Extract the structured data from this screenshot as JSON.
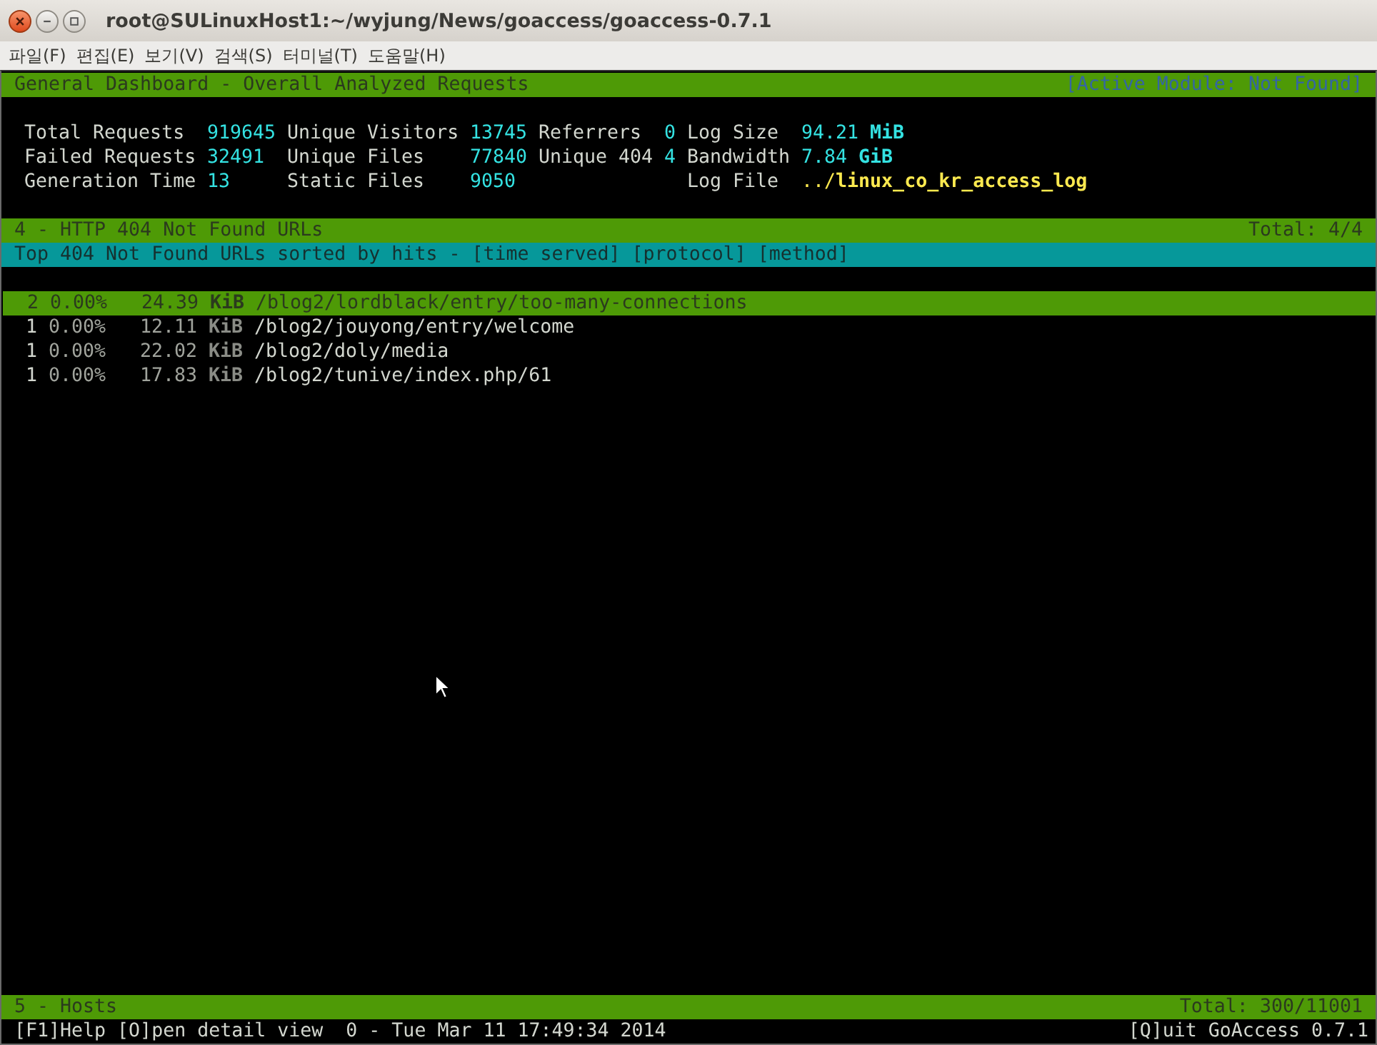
{
  "window": {
    "title": "root@SULinuxHost1:~/wyjung/News/goaccess/goaccess-0.7.1"
  },
  "menu": [
    "파일(F)",
    "편집(E)",
    "보기(V)",
    "검색(S)",
    "터미널(T)",
    "도움말(H)"
  ],
  "header": {
    "title": "General Dashboard - Overall Analyzed Requests",
    "active_module": "[Active Module: Not Found]"
  },
  "stats": [
    {
      "items": [
        {
          "label": "Total Requests",
          "value": "919645",
          "kind": "number"
        },
        {
          "label": "Failed Requests",
          "value": "32491",
          "kind": "number"
        },
        {
          "label": "Generation Time",
          "value": "13",
          "kind": "number"
        }
      ]
    },
    {
      "items": [
        {
          "label": "Unique Visitors",
          "value": "13745",
          "kind": "number"
        },
        {
          "label": "Unique Files",
          "value": "77840",
          "kind": "number"
        },
        {
          "label": "Static Files",
          "value": "9050",
          "kind": "number"
        }
      ]
    },
    {
      "items": [
        {
          "label": "Referrers",
          "value": "0",
          "kind": "number"
        },
        {
          "label": "Unique 404",
          "value": "4",
          "kind": "number"
        }
      ]
    },
    {
      "items": [
        {
          "label": "Log Size",
          "value": "94.21 **MiB**",
          "kind": "number"
        },
        {
          "label": "Bandwidth",
          "value": "7.84 **GiB**",
          "kind": "number"
        },
        {
          "label": "Log File",
          "value": "../**linux_co_kr_access_log**",
          "kind": "path"
        }
      ]
    }
  ],
  "module": {
    "title": "4 - HTTP 404 Not Found URLs",
    "total": "Total: 4/4",
    "subtitle": "Top 404 Not Found URLs sorted by hits - [time served] [protocol] [method]",
    "rows": [
      {
        "hits": "2",
        "percent": "0.00%",
        "bandwidth": "24.39 **KiB**",
        "url": "/blog2/lordblack/entry/too-many-connections",
        "selected": true
      },
      {
        "hits": "1",
        "percent": "0.00%",
        "bandwidth": "12.11 **KiB**",
        "url": "/blog2/jouyong/entry/welcome",
        "selected": false
      },
      {
        "hits": "1",
        "percent": "0.00%",
        "bandwidth": "22.02 **KiB**",
        "url": "/blog2/doly/media",
        "selected": false
      },
      {
        "hits": "1",
        "percent": "0.00%",
        "bandwidth": "17.83 **KiB**",
        "url": "/blog2/tunive/index.php/61",
        "selected": false
      }
    ]
  },
  "next_module": {
    "title": "5 - Hosts",
    "total": "Total: 300/11001"
  },
  "footer": {
    "help": "[F1]Help [O]pen detail view",
    "date": "0 - Tue Mar 11 17:49:34 2014",
    "quit": "[Q]uit GoAccess 0.7.1"
  }
}
